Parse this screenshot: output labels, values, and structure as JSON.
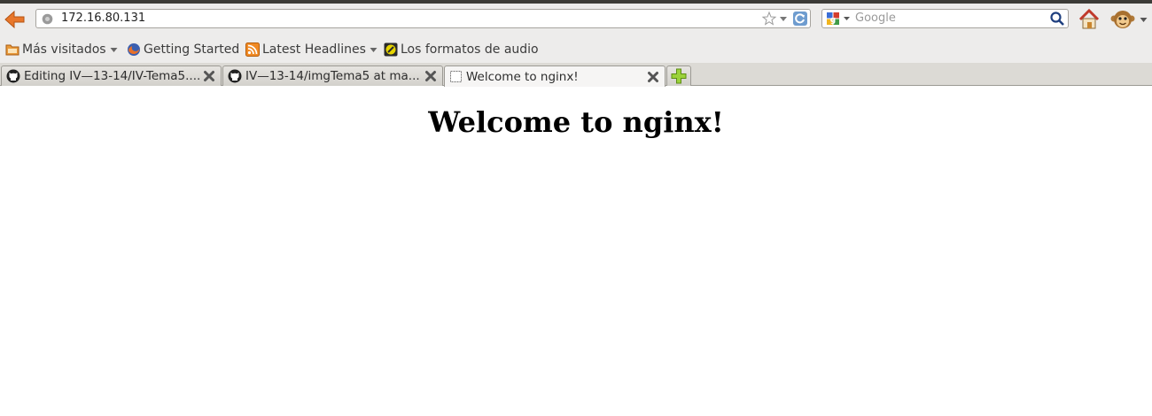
{
  "toolbar": {
    "url": "172.16.80.131",
    "search_placeholder": "Google",
    "icons": [
      "back-arrow-icon",
      "globe-icon",
      "star-icon",
      "dropdown-arrow-icon",
      "reload-icon",
      "google-icon",
      "magnifier-icon",
      "home-icon",
      "monkey-icon"
    ]
  },
  "bookmarks": [
    {
      "label": "Más visitados",
      "icon": "folder-icon",
      "dropdown": true
    },
    {
      "label": "Getting Started",
      "icon": "firefox-icon",
      "dropdown": false
    },
    {
      "label": "Latest Headlines",
      "icon": "rss-icon",
      "dropdown": true
    },
    {
      "label": "Los formatos de audio",
      "icon": "audio-format-icon",
      "dropdown": false
    }
  ],
  "tabs": [
    {
      "title": "Editing IV—13-14/IV-Tema5....",
      "icon": "github-icon",
      "active": false
    },
    {
      "title": "IV—13-14/imgTema5 at ma...",
      "icon": "github-icon",
      "active": false
    },
    {
      "title": "Welcome to nginx!",
      "icon": "blank-page-icon",
      "active": true
    }
  ],
  "page": {
    "heading": "Welcome to nginx!"
  },
  "colors": {
    "chrome_background": "#edeceb",
    "title_bar": "#3c3b37",
    "back_arrow": "#e46f1c",
    "page_background": "#ffffff"
  }
}
